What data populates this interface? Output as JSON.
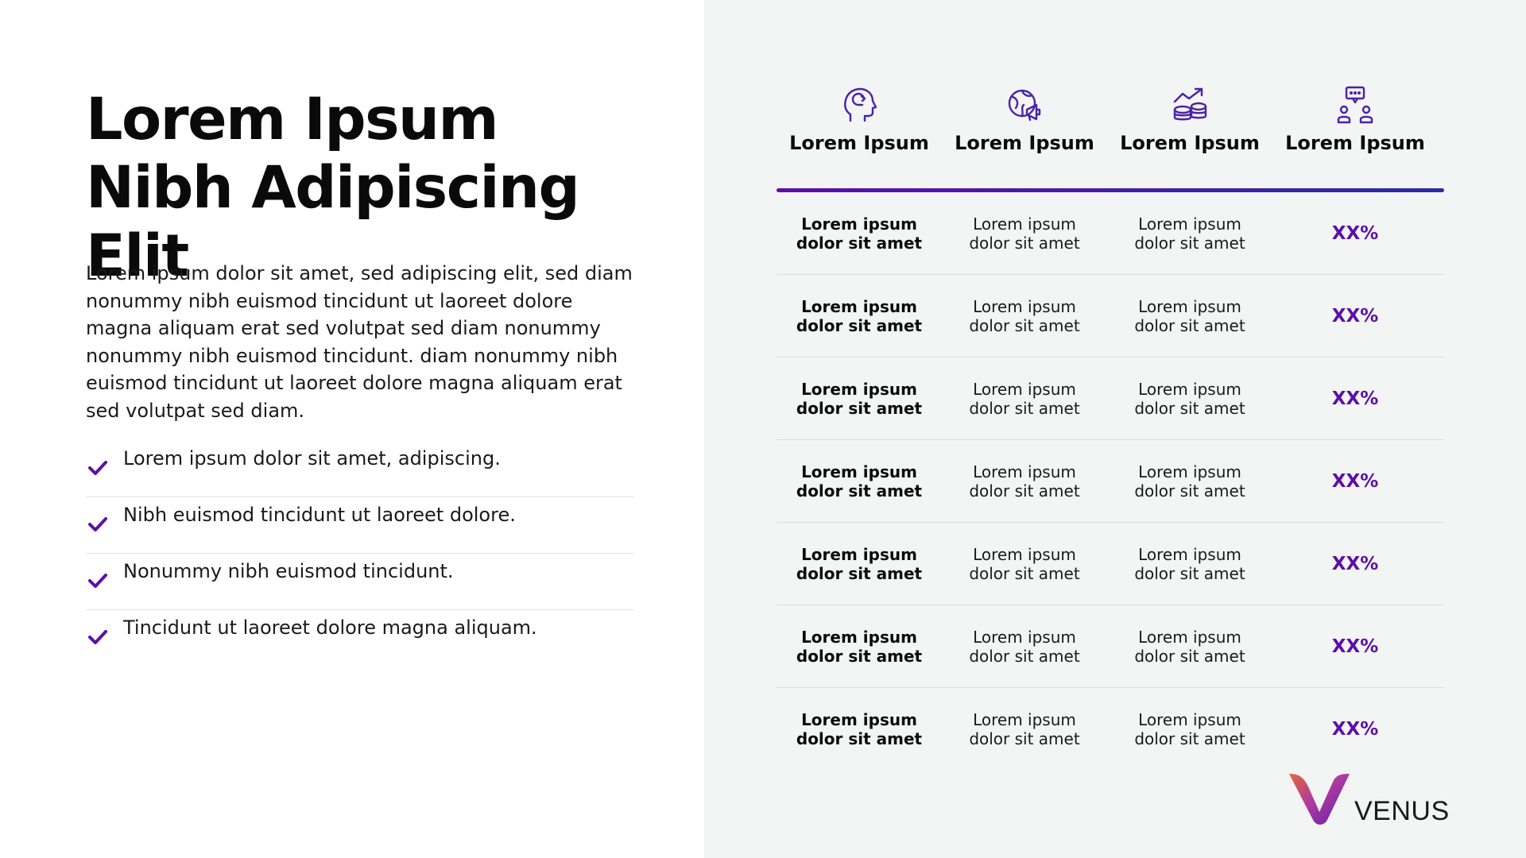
{
  "title": "Lorem Ipsum Nibh Adipiscing Elit",
  "intro": "Lorem ipsum dolor sit  amet, sed adipiscing elit, sed diam nonummy nibh euismod tincidunt ut laoreet dolore magna aliquam erat sed volutpat sed diam nonummy nonummy nibh euismod tincidunt. diam nonummy nibh euismod tincidunt ut laoreet dolore magna aliquam erat sed volutpat sed diam.",
  "bullets": [
    "Lorem ipsum dolor sit amet, adipiscing.",
    "Nibh euismod tincidunt ut laoreet dolore.",
    "Nonummy nibh euismod tincidunt.",
    "Tincidunt ut laoreet dolore magna aliquam."
  ],
  "table": {
    "headers": [
      {
        "label": "Lorem Ipsum",
        "icon": "head-idea-icon"
      },
      {
        "label": "Lorem Ipsum",
        "icon": "globe-megaphone-icon"
      },
      {
        "label": "Lorem Ipsum",
        "icon": "coins-growth-icon"
      },
      {
        "label": "Lorem Ipsum",
        "icon": "team-chat-icon"
      }
    ],
    "rows": [
      {
        "c1": "Lorem ipsum dolor sit amet",
        "c2": "Lorem ipsum dolor sit amet",
        "c3": "Lorem ipsum dolor sit amet",
        "c4": "XX%"
      },
      {
        "c1": "Lorem ipsum dolor sit amet",
        "c2": "Lorem ipsum dolor sit amet",
        "c3": "Lorem ipsum dolor sit amet",
        "c4": "XX%"
      },
      {
        "c1": "Lorem ipsum dolor sit amet",
        "c2": "Lorem ipsum dolor sit amet",
        "c3": "Lorem ipsum dolor sit amet",
        "c4": "XX%"
      },
      {
        "c1": "Lorem ipsum dolor sit amet",
        "c2": "Lorem ipsum dolor sit amet",
        "c3": "Lorem ipsum dolor sit amet",
        "c4": "XX%"
      },
      {
        "c1": "Lorem ipsum dolor sit amet",
        "c2": "Lorem ipsum dolor sit amet",
        "c3": "Lorem ipsum dolor sit amet",
        "c4": "XX%"
      },
      {
        "c1": "Lorem ipsum dolor sit amet",
        "c2": "Lorem ipsum dolor sit amet",
        "c3": "Lorem ipsum dolor sit amet",
        "c4": "XX%"
      },
      {
        "c1": "Lorem ipsum dolor sit amet",
        "c2": "Lorem ipsum dolor sit amet",
        "c3": "Lorem ipsum dolor sit amet",
        "c4": "XX%"
      }
    ]
  },
  "logo": {
    "text": "VENUS"
  },
  "colors": {
    "accent": "#5b0fa8",
    "panel": "#f3f4f4",
    "rule_end": "#2b2aa6"
  }
}
